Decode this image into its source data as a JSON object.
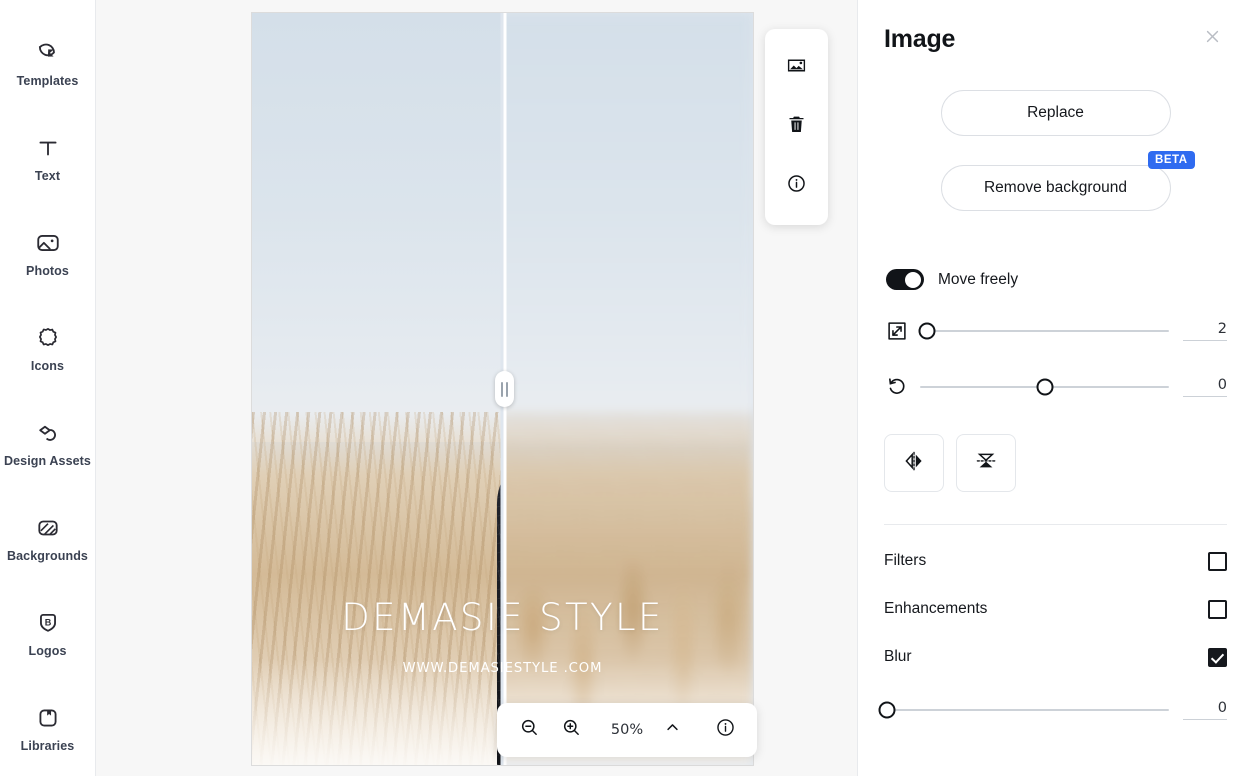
{
  "sidebar": {
    "items": [
      {
        "label": "Templates",
        "icon": "templates-icon"
      },
      {
        "label": "Text",
        "icon": "text-icon"
      },
      {
        "label": "Photos",
        "icon": "photos-icon"
      },
      {
        "label": "Icons",
        "icon": "icons-icon"
      },
      {
        "label": "Design Assets",
        "icon": "design-assets-icon"
      },
      {
        "label": "Backgrounds",
        "icon": "backgrounds-icon"
      },
      {
        "label": "Logos",
        "icon": "logos-icon"
      },
      {
        "label": "Libraries",
        "icon": "libraries-icon"
      }
    ]
  },
  "canvas": {
    "artwork_title": "DEMASIE STYLE",
    "artwork_subtitle": "WWW.DEMASIESTYLE .COM",
    "split_handle": "before-after-split-handle"
  },
  "object_toolbar": {
    "buttons": [
      {
        "name": "replace-image-icon",
        "title": "Image"
      },
      {
        "name": "delete-icon",
        "title": "Delete"
      },
      {
        "name": "info-icon",
        "title": "Info"
      }
    ]
  },
  "zoom_bar": {
    "zoom_out": "zoom-out-icon",
    "zoom_in": "zoom-in-icon",
    "level": "50%",
    "chevron": "chevron-up-icon",
    "info": "info-icon"
  },
  "panel": {
    "title": "Image",
    "close": "close-icon",
    "replace_label": "Replace",
    "remove_background_label": "Remove background",
    "beta_badge": "BETA",
    "beta_color": "#2f6bf0",
    "move_freely_label": "Move freely",
    "move_freely_on": true,
    "sliders": [
      {
        "name": "scale-slider",
        "icon": "resize-icon",
        "value": "2",
        "handle_pct": 3
      },
      {
        "name": "rotate-slider",
        "icon": "rotate-icon",
        "value": "0",
        "handle_pct": 50
      }
    ],
    "flip_buttons": [
      {
        "name": "flip-horizontal-button",
        "icon": "flip-horizontal-icon"
      },
      {
        "name": "flip-vertical-button",
        "icon": "flip-vertical-icon"
      }
    ],
    "effects": [
      {
        "label": "Filters",
        "checked": false
      },
      {
        "label": "Enhancements",
        "checked": false
      },
      {
        "label": "Blur",
        "checked": true
      }
    ],
    "blur_slider": {
      "name": "blur-slider",
      "value": "0",
      "handle_pct": 1
    }
  }
}
